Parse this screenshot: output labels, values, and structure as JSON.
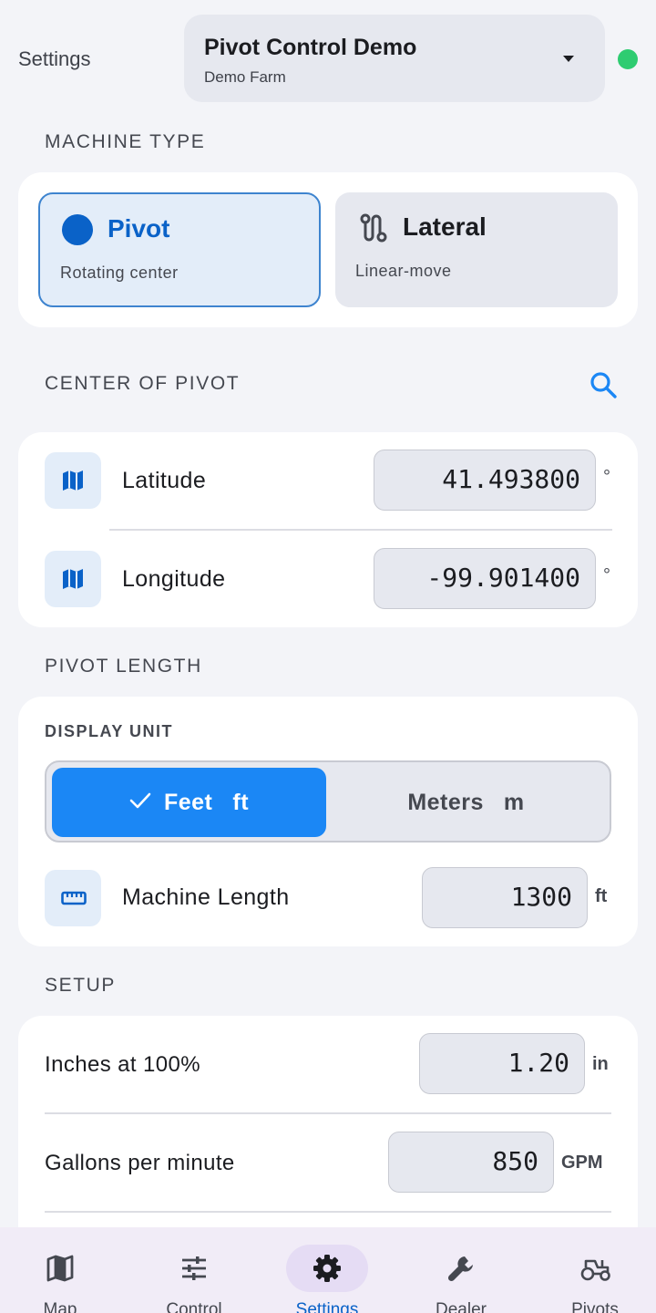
{
  "header": {
    "title": "Settings",
    "farm_select": {
      "name": "Pivot Control Demo",
      "farm": "Demo Farm"
    },
    "status_color": "#2ecc71"
  },
  "machine_type": {
    "section_title": "MACHINE TYPE",
    "options": [
      {
        "title": "Pivot",
        "subtitle": "Rotating center",
        "selected": true
      },
      {
        "title": "Lateral",
        "subtitle": "Linear-move",
        "selected": false
      }
    ]
  },
  "center": {
    "section_title": "CENTER OF PIVOT",
    "rows": [
      {
        "label": "Latitude",
        "value": "41.493800",
        "unit": "°"
      },
      {
        "label": "Longitude",
        "value": "-99.901400",
        "unit": "°"
      }
    ]
  },
  "length": {
    "section_title": "PIVOT LENGTH",
    "display_unit_label": "DISPLAY UNIT",
    "units": [
      {
        "name": "Feet",
        "abbr": "ft",
        "selected": true
      },
      {
        "name": "Meters",
        "abbr": "m",
        "selected": false
      }
    ],
    "machine_length": {
      "label": "Machine Length",
      "value": "1300",
      "unit": "ft"
    }
  },
  "setup": {
    "section_title": "SETUP",
    "rows": [
      {
        "label": "Inches at 100%",
        "value": "1.20",
        "unit": "in"
      },
      {
        "label": "Gallons per minute",
        "value": "850",
        "unit": "GPM"
      }
    ]
  },
  "nav": {
    "items": [
      {
        "label": "Map",
        "icon": "map-icon",
        "active": false
      },
      {
        "label": "Control",
        "icon": "sliders-icon",
        "active": false
      },
      {
        "label": "Settings",
        "icon": "gear-icon",
        "active": true
      },
      {
        "label": "Dealer",
        "icon": "wrench-icon",
        "active": false
      },
      {
        "label": "Pivots",
        "icon": "tractor-icon",
        "active": false
      }
    ]
  },
  "colors": {
    "accent": "#1b87f5",
    "primary": "#0a62c8",
    "background": "#f3f4f8"
  }
}
